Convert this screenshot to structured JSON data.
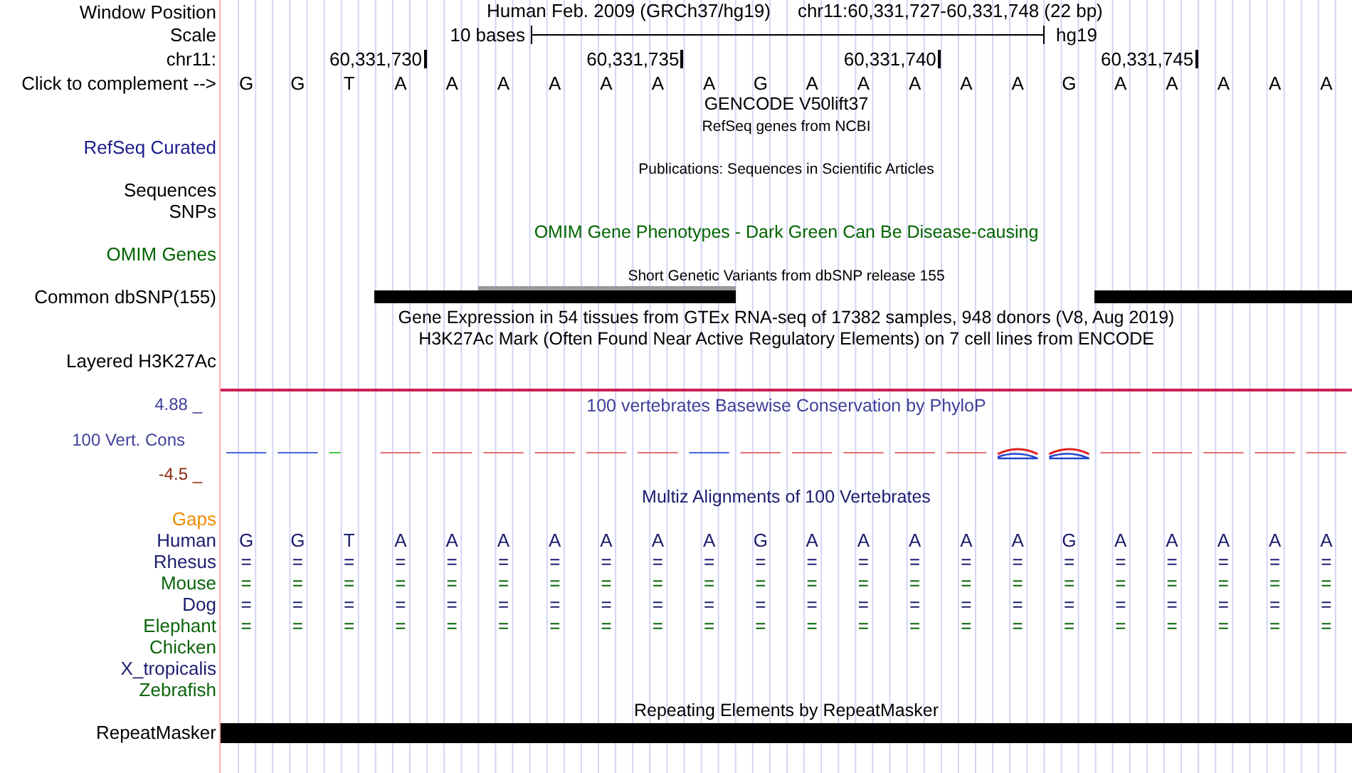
{
  "header": {
    "label": "Window Position",
    "assembly": "Human Feb. 2009 (GRCh37/hg19)",
    "position": "chr11:60,331,727-60,331,748 (22 bp)"
  },
  "scale": {
    "label": "Scale",
    "length": "10 bases",
    "db": "hg19"
  },
  "ruler": {
    "label": "chr11:",
    "ticks": [
      "60,331,730",
      "60,331,735",
      "60,331,740",
      "60,331,745"
    ]
  },
  "sequence": {
    "label": "Click to complement -->",
    "bases": [
      "G",
      "G",
      "T",
      "A",
      "A",
      "A",
      "A",
      "A",
      "A",
      "A",
      "G",
      "A",
      "A",
      "A",
      "A",
      "A",
      "G",
      "A",
      "A",
      "A",
      "A",
      "A"
    ]
  },
  "tracks": [
    {
      "kind": "title",
      "title": "GENCODE V50lift37",
      "color": "#000000"
    },
    {
      "kind": "subtitle",
      "title": "RefSeq genes from NCBI",
      "color": "#000000"
    },
    {
      "kind": "label",
      "label": "RefSeq Curated",
      "color": "#1c1c8c"
    },
    {
      "kind": "subtitle",
      "title": "Publications: Sequences in Scientific Articles",
      "color": "#000000"
    },
    {
      "kind": "label",
      "label": "Sequences",
      "color": "#000000"
    },
    {
      "kind": "label",
      "label": "SNPs",
      "color": "#000000"
    },
    {
      "kind": "title",
      "title": "OMIM Gene Phenotypes - Dark Green Can Be Disease-causing",
      "color": "#006400"
    },
    {
      "kind": "label",
      "label": "OMIM Genes",
      "color": "#006400"
    },
    {
      "kind": "subtitle",
      "title": "Short Genetic Variants from dbSNP release 155",
      "color": "#000000"
    },
    {
      "kind": "bars",
      "label": "Common dbSNP(155)",
      "color": "#000000"
    },
    {
      "kind": "title",
      "title": "Gene Expression in 54 tissues from GTEx RNA-seq of 17382 samples, 948 donors (V8, Aug 2019)",
      "color": "#000000"
    },
    {
      "kind": "title",
      "title": "H3K27Ac Mark (Often Found Near Active Regulatory Elements) on 7 cell lines from ENCODE",
      "color": "#000000"
    },
    {
      "kind": "label",
      "label": "Layered H3K27Ac",
      "color": "#000000"
    },
    {
      "kind": "separator",
      "color": "#cc1f55"
    },
    {
      "kind": "conservation",
      "title": "100 vertebrates Basewise Conservation by PhyloP",
      "max": "4.88 _",
      "label": "100 Vert. Cons",
      "min": "-4.5 _",
      "color": "#40409a"
    },
    {
      "kind": "title",
      "title": "Multiz Alignments of 100 Vertebrates",
      "color": "#1c1c6e"
    },
    {
      "kind": "label",
      "label": "Gaps",
      "color": "#f08c00"
    },
    {
      "kind": "alignment",
      "label": "Human",
      "color": "#1c1c6e",
      "bases": [
        "G",
        "G",
        "T",
        "A",
        "A",
        "A",
        "A",
        "A",
        "A",
        "A",
        "G",
        "A",
        "A",
        "A",
        "A",
        "A",
        "G",
        "A",
        "A",
        "A",
        "A",
        "A"
      ]
    },
    {
      "kind": "alignment",
      "label": "Rhesus",
      "color": "#1c1c6e",
      "bases": [
        "=",
        "=",
        "=",
        "=",
        "=",
        "=",
        "=",
        "=",
        "=",
        "=",
        "=",
        "=",
        "=",
        "=",
        "=",
        "=",
        "=",
        "=",
        "=",
        "=",
        "=",
        "="
      ]
    },
    {
      "kind": "alignment",
      "label": "Mouse",
      "color": "#0a640a",
      "bases": [
        "=",
        "=",
        "=",
        "=",
        "=",
        "=",
        "=",
        "=",
        "=",
        "=",
        "=",
        "=",
        "=",
        "=",
        "=",
        "=",
        "=",
        "=",
        "=",
        "=",
        "=",
        "="
      ]
    },
    {
      "kind": "alignment",
      "label": "Dog",
      "color": "#1c1c6e",
      "bases": [
        "=",
        "=",
        "=",
        "=",
        "=",
        "=",
        "=",
        "=",
        "=",
        "=",
        "=",
        "=",
        "=",
        "=",
        "=",
        "=",
        "=",
        "=",
        "=",
        "=",
        "=",
        "="
      ]
    },
    {
      "kind": "alignment",
      "label": "Elephant",
      "color": "#0a640a",
      "bases": [
        "=",
        "=",
        "=",
        "=",
        "=",
        "=",
        "=",
        "=",
        "=",
        "=",
        "=",
        "=",
        "=",
        "=",
        "=",
        "=",
        "=",
        "=",
        "=",
        "=",
        "=",
        "="
      ]
    },
    {
      "kind": "label",
      "label": "Chicken",
      "color": "#0a640a"
    },
    {
      "kind": "label",
      "label": "X_tropicalis",
      "color": "#1c1c6e"
    },
    {
      "kind": "label",
      "label": "Zebrafish",
      "color": "#0a640a"
    },
    {
      "kind": "title",
      "title": "Repeating Elements by RepeatMasker",
      "color": "#000000"
    },
    {
      "kind": "fullbar",
      "label": "RepeatMasker",
      "color": "#000000"
    }
  ]
}
